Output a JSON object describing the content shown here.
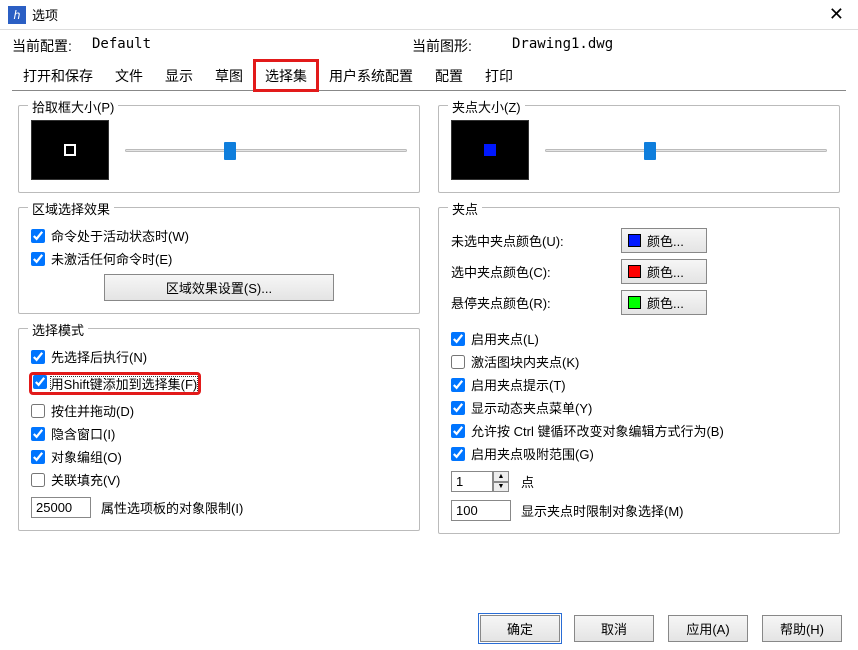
{
  "window": {
    "title": "选项",
    "app_icon": "h"
  },
  "config": {
    "current_profile_label": "当前配置:",
    "current_profile": "Default",
    "current_drawing_label": "当前图形:",
    "current_drawing": "Drawing1.dwg"
  },
  "tabs": [
    {
      "label": "打开和保存",
      "active": false
    },
    {
      "label": "文件",
      "active": false
    },
    {
      "label": "显示",
      "active": false
    },
    {
      "label": "草图",
      "active": false
    },
    {
      "label": "选择集",
      "active": true,
      "highlight": true
    },
    {
      "label": "用户系统配置",
      "active": false
    },
    {
      "label": "配置",
      "active": false
    },
    {
      "label": "打印",
      "active": false
    }
  ],
  "left": {
    "pickbox_title": "拾取框大小(P)",
    "region_title": "区域选择效果",
    "region_cmd_active": "命令处于活动状态时(W)",
    "region_no_cmd": "未激活任何命令时(E)",
    "region_settings_btn": "区域效果设置(S)...",
    "mode_title": "选择模式",
    "mode_select_first": "先选择后执行(N)",
    "mode_shift_add": "用Shift键添加到选择集(F)",
    "mode_press_drag": "按住并拖动(D)",
    "mode_implied_window": "隐含窗口(I)",
    "mode_object_group": "对象编组(O)",
    "mode_assoc_hatch": "关联填充(V)",
    "mode_limit_value": "25000",
    "mode_limit_label": "属性选项板的对象限制(I)"
  },
  "right": {
    "grip_title": "夹点大小(Z)",
    "grips_title": "夹点",
    "color_unselected_label": "未选中夹点颜色(U):",
    "color_selected_label": "选中夹点颜色(C):",
    "color_hover_label": "悬停夹点颜色(R):",
    "color_btn_label": "颜色...",
    "colors": {
      "unselected": "#0018ff",
      "selected": "#ff0000",
      "hover": "#00ff00"
    },
    "grips_enable": "启用夹点(L)",
    "grips_in_blocks": "激活图块内夹点(K)",
    "grips_tips": "启用夹点提示(T)",
    "grips_dyn_menu": "显示动态夹点菜单(Y)",
    "grips_ctrl_cycle": "允许按 Ctrl 键循环改变对象编辑方式行为(B)",
    "grips_snap": "启用夹点吸附范围(G)",
    "grips_point_value": "1",
    "grips_point_label": "点",
    "grips_limit_value": "100",
    "grips_limit_label": "显示夹点时限制对象选择(M)"
  },
  "footer": {
    "ok": "确定",
    "cancel": "取消",
    "apply": "应用(A)",
    "help": "帮助(H)"
  },
  "checks": {
    "region_cmd_active": true,
    "region_no_cmd": true,
    "mode_select_first": true,
    "mode_shift_add": true,
    "mode_press_drag": false,
    "mode_implied_window": true,
    "mode_object_group": true,
    "mode_assoc_hatch": false,
    "grips_enable": true,
    "grips_in_blocks": false,
    "grips_tips": true,
    "grips_dyn_menu": true,
    "grips_ctrl_cycle": true,
    "grips_snap": true
  }
}
